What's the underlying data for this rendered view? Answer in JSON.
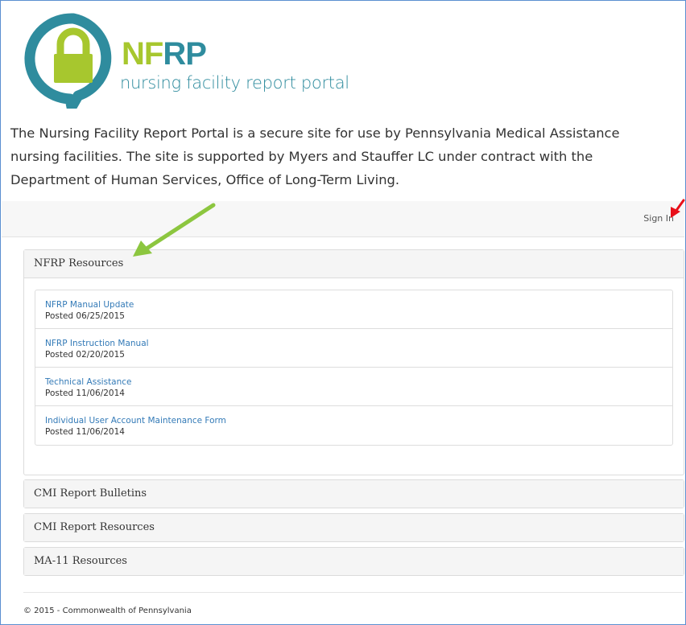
{
  "header": {
    "logo_abbr_1": "NF",
    "logo_abbr_2": "RP",
    "logo_subtitle": "nursing facility report portal"
  },
  "intro": {
    "text": "The Nursing Facility Report Portal is a secure site for use by Pennsylvania Medical Assistance nursing facilities. The site is supported by Myers and Stauffer LC under contract with the Department of Human Services, Office of Long-Term Living."
  },
  "nav": {
    "signin_label": "Sign In"
  },
  "panels": [
    {
      "title": "NFRP Resources",
      "items": [
        {
          "link": "NFRP Manual Update",
          "posted": "Posted 06/25/2015"
        },
        {
          "link": "NFRP Instruction Manual",
          "posted": "Posted 02/20/2015"
        },
        {
          "link": "Technical Assistance",
          "posted": "Posted 11/06/2014"
        },
        {
          "link": "Individual User Account Maintenance Form",
          "posted": "Posted 11/06/2014"
        }
      ]
    },
    {
      "title": "CMI Report Bulletins"
    },
    {
      "title": "CMI Report Resources"
    },
    {
      "title": "MA-11 Resources"
    }
  ],
  "footer": {
    "text": "© 2015 - Commonwealth of Pennsylvania"
  },
  "colors": {
    "logo_green": "#a7c72e",
    "logo_teal": "#2f8c9e",
    "link_blue": "#337ab7",
    "annotation_green_arrow": "#8cc63f",
    "annotation_red_arrow": "#e8101a"
  },
  "icons": {
    "logo_mark": "padlock-speech-bubble-icon"
  }
}
